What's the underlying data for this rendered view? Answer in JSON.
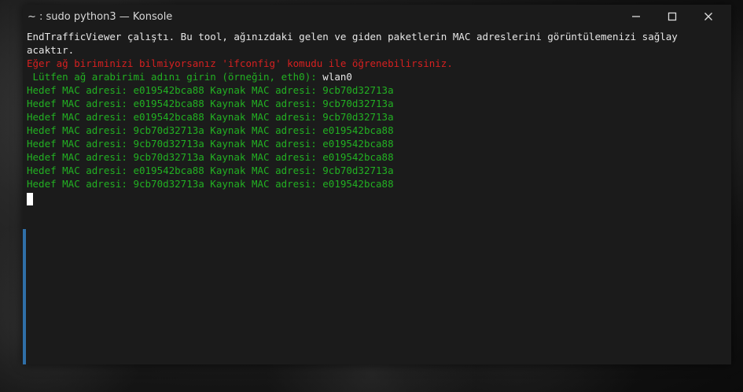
{
  "window": {
    "title": "~ : sudo python3 — Konsole",
    "controls": {
      "minimize_icon": "minimize-icon",
      "maximize_icon": "maximize-icon",
      "close_icon": "close-icon"
    }
  },
  "terminal": {
    "intro_line1": "EndTrafficViewer çalıştı. Bu tool, ağınızdaki gelen ve giden paketlerin MAC adreslerini görüntülemenizi sağlay",
    "intro_line2": "acaktır.",
    "warning": "Eğer ağ biriminizi bilmiyorsanız 'ifconfig' komudu ile öğrenebilirsiniz.",
    "prompt": " Lütfen ağ arabirimi adını girin (örneğin, eth0): ",
    "input_value": "wlan0",
    "output_lines": [
      "Hedef MAC adresi: e019542bca88 Kaynak MAC adresi: 9cb70d32713a",
      "Hedef MAC adresi: e019542bca88 Kaynak MAC adresi: 9cb70d32713a",
      "Hedef MAC adresi: e019542bca88 Kaynak MAC adresi: 9cb70d32713a",
      "Hedef MAC adresi: 9cb70d32713a Kaynak MAC adresi: e019542bca88",
      "Hedef MAC adresi: 9cb70d32713a Kaynak MAC adresi: e019542bca88",
      "Hedef MAC adresi: 9cb70d32713a Kaynak MAC adresi: e019542bca88",
      "Hedef MAC adresi: e019542bca88 Kaynak MAC adresi: 9cb70d32713a",
      "Hedef MAC adresi: 9cb70d32713a Kaynak MAC adresi: e019542bca88"
    ]
  },
  "colors": {
    "text": "#e6e6e6",
    "warning": "#d62020",
    "output": "#22b022",
    "accent": "#2f6fa8"
  }
}
